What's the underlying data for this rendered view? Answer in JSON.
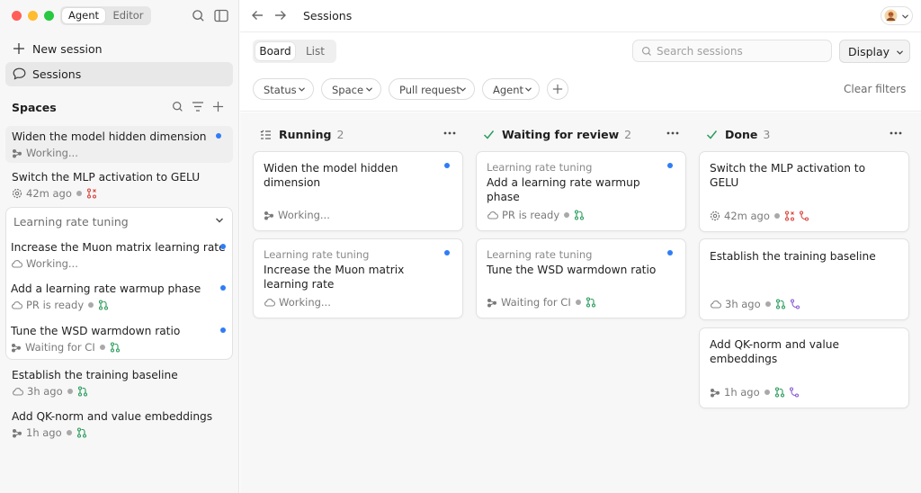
{
  "sidebar": {
    "segmented": {
      "agent": "Agent",
      "editor": "Editor"
    },
    "nav": {
      "new_session": "New session",
      "sessions": "Sessions"
    },
    "spaces_title": "Spaces",
    "items_top": [
      {
        "title": "Widen the model hidden dimension",
        "meta": "Working..."
      },
      {
        "title": "Switch the MLP activation to GELU",
        "meta": "42m ago"
      }
    ],
    "group": {
      "label": "Learning rate tuning",
      "items": [
        {
          "title": "Increase the Muon matrix learning rate",
          "meta": "Working..."
        },
        {
          "title": "Add a learning rate warmup phase",
          "meta": "PR is ready"
        },
        {
          "title": "Tune the WSD warmdown ratio",
          "meta": "Waiting for CI"
        }
      ]
    },
    "items_bottom": [
      {
        "title": "Establish the training baseline",
        "meta": "3h ago"
      },
      {
        "title": "Add QK-norm and value embeddings",
        "meta": "1h ago"
      }
    ]
  },
  "header": {
    "title": "Sessions"
  },
  "toolbar": {
    "view_board": "Board",
    "view_list": "List",
    "search_placeholder": "Search sessions",
    "display": "Display",
    "filters": [
      "Status",
      "Space",
      "Pull request",
      "Agent"
    ],
    "clear_filters": "Clear filters"
  },
  "board": {
    "columns": [
      {
        "label": "Running",
        "count": "2",
        "cards": [
          {
            "space": "",
            "title": "Widen the model hidden dimension",
            "meta": "Working..."
          },
          {
            "space": "Learning rate tuning",
            "title": "Increase the Muon matrix learning rate",
            "meta": "Working..."
          }
        ]
      },
      {
        "label": "Waiting for review",
        "count": "2",
        "cards": [
          {
            "space": "Learning rate tuning",
            "title": "Add a learning rate warmup phase",
            "meta": "PR is ready"
          },
          {
            "space": "Learning rate tuning",
            "title": "Tune the WSD warmdown ratio",
            "meta": "Waiting for CI"
          }
        ]
      },
      {
        "label": "Done",
        "count": "3",
        "cards": [
          {
            "space": "",
            "title": "Switch the MLP activation to GELU",
            "meta": "42m ago"
          },
          {
            "space": "",
            "title": "Establish the training baseline",
            "meta": "3h ago"
          },
          {
            "space": "",
            "title": "Add QK-norm and value embeddings",
            "meta": "1h ago"
          }
        ]
      }
    ]
  },
  "colors": {
    "unread_dot": "#2f7df6",
    "pr_open": "#2a9d5c",
    "pr_closed": "#d9453d",
    "pr_merged": "#8a5cd6",
    "check": "#2a9d5c",
    "traffic_red": "#ff5f57",
    "traffic_yellow": "#febc2e",
    "traffic_green": "#28c840"
  }
}
